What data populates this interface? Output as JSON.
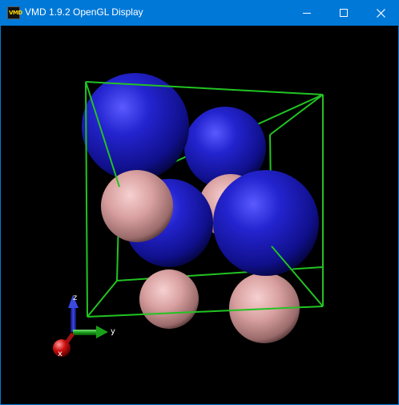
{
  "window": {
    "title": "VMD 1.9.2 OpenGL Display",
    "app_icon_text": "VMD",
    "controls": {
      "minimize": "minimize",
      "maximize": "maximize",
      "close": "close"
    }
  },
  "viewport": {
    "background": "#000000",
    "unit_cell_color": "#22c322",
    "atom_colors": {
      "large": "#1a1ab4",
      "small": "#d9a0a0"
    }
  },
  "axes": {
    "x_label": "x",
    "y_label": "y",
    "z_label": "z",
    "x_color": "#d01010",
    "y_color": "#1aa01a",
    "z_color": "#2030d0"
  },
  "colors": {
    "titlebar": "#0078d7",
    "titlebar_text": "#ffffff"
  }
}
